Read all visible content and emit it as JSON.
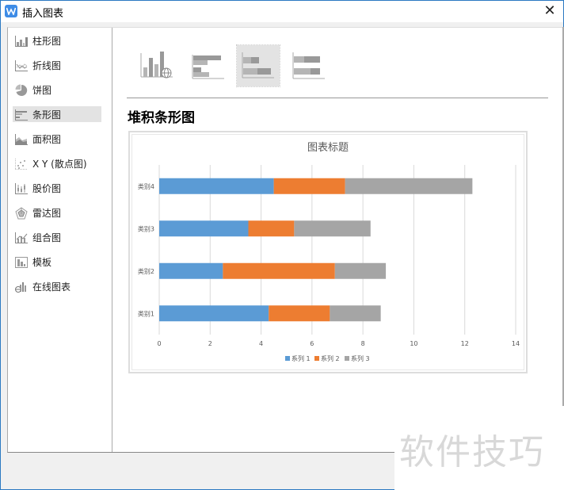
{
  "window": {
    "title": "插入图表",
    "close_symbol": "✕",
    "accent": "#2b79c2"
  },
  "sidebar": {
    "items": [
      {
        "label": "柱形图",
        "icon": "column-chart-icon",
        "selected": false
      },
      {
        "label": "折线图",
        "icon": "line-chart-icon",
        "selected": false
      },
      {
        "label": "饼图",
        "icon": "pie-chart-icon",
        "selected": false
      },
      {
        "label": "条形图",
        "icon": "bar-chart-icon",
        "selected": true
      },
      {
        "label": "面积图",
        "icon": "area-chart-icon",
        "selected": false
      },
      {
        "label": "X Y (散点图)",
        "icon": "scatter-chart-icon",
        "selected": false
      },
      {
        "label": "股价图",
        "icon": "stock-chart-icon",
        "selected": false
      },
      {
        "label": "雷达图",
        "icon": "radar-chart-icon",
        "selected": false
      },
      {
        "label": "组合图",
        "icon": "combo-chart-icon",
        "selected": false
      },
      {
        "label": "模板",
        "icon": "template-icon",
        "selected": false
      },
      {
        "label": "在线图表",
        "icon": "online-chart-icon",
        "selected": false
      }
    ]
  },
  "main": {
    "subtypes": [
      {
        "name": "online-bar-chart",
        "selected": false
      },
      {
        "name": "clustered-bar",
        "selected": false
      },
      {
        "name": "stacked-bar",
        "selected": true
      },
      {
        "name": "percent-stacked-bar",
        "selected": false
      }
    ],
    "subtitle": "堆积条形图"
  },
  "chart_data": {
    "type": "bar",
    "orientation": "horizontal",
    "stacked": true,
    "title": "图表标题",
    "categories": [
      "类别1",
      "类别2",
      "类别3",
      "类别4"
    ],
    "series": [
      {
        "name": "系列 1",
        "color": "#5b9bd5",
        "values": [
          4.3,
          2.5,
          3.5,
          4.5
        ]
      },
      {
        "name": "系列 2",
        "color": "#ed7d31",
        "values": [
          2.4,
          4.4,
          1.8,
          2.8
        ]
      },
      {
        "name": "系列 3",
        "color": "#a5a5a5",
        "values": [
          2,
          2,
          3,
          5
        ]
      }
    ],
    "xlabel": "",
    "ylabel": "",
    "xlim": [
      0,
      14
    ],
    "xticks": [
      0,
      2,
      4,
      6,
      8,
      10,
      12,
      14
    ],
    "grid": true,
    "legend": "bottom"
  },
  "watermark": "软件技巧"
}
